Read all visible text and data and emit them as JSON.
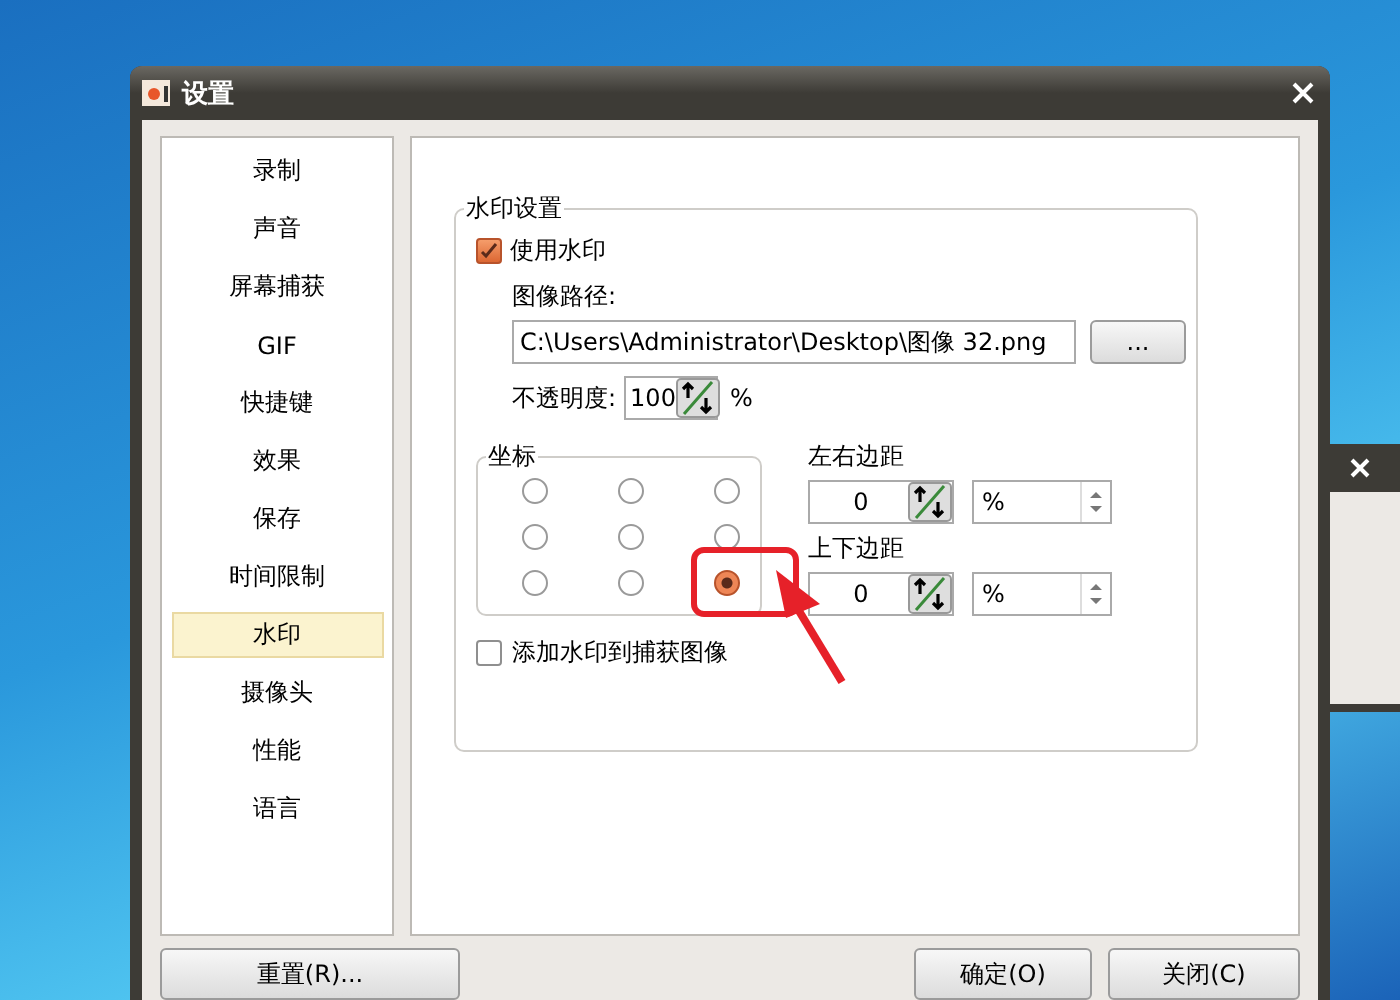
{
  "window": {
    "title": "设置"
  },
  "sidebar": {
    "items": [
      {
        "label": "录制",
        "selected": false
      },
      {
        "label": "声音",
        "selected": false
      },
      {
        "label": "屏幕捕获",
        "selected": false
      },
      {
        "label": "GIF",
        "selected": false
      },
      {
        "label": "快捷键",
        "selected": false
      },
      {
        "label": "效果",
        "selected": false
      },
      {
        "label": "保存",
        "selected": false
      },
      {
        "label": "时间限制",
        "selected": false
      },
      {
        "label": "水印",
        "selected": true
      },
      {
        "label": "摄像头",
        "selected": false
      },
      {
        "label": "性能",
        "selected": false
      },
      {
        "label": "语言",
        "selected": false
      }
    ]
  },
  "watermark": {
    "title": "水印设置",
    "use_watermark": {
      "label": "使用水印",
      "checked": true
    },
    "image_path": {
      "label": "图像路径:",
      "value": "C:\\Users\\Administrator\\Desktop\\图像 32.png"
    },
    "browse_button": "...",
    "opacity": {
      "label": "不透明度:",
      "value": "100",
      "unit": "%"
    },
    "position": {
      "title": "坐标",
      "options": [
        {
          "selected": false
        },
        {
          "selected": false
        },
        {
          "selected": false
        },
        {
          "selected": false
        },
        {
          "selected": false
        },
        {
          "selected": false
        },
        {
          "selected": false
        },
        {
          "selected": false
        },
        {
          "selected": true
        }
      ]
    },
    "margins": [
      {
        "label": "左右边距",
        "value": "0",
        "unit": "%"
      },
      {
        "label": "上下边距",
        "value": "0",
        "unit": "%"
      }
    ],
    "add_to_capture": {
      "label": "添加水印到捕获图像",
      "checked": false
    }
  },
  "buttons": {
    "reset": "重置(R)...",
    "ok": "确定(O)",
    "close": "关闭(C)"
  }
}
